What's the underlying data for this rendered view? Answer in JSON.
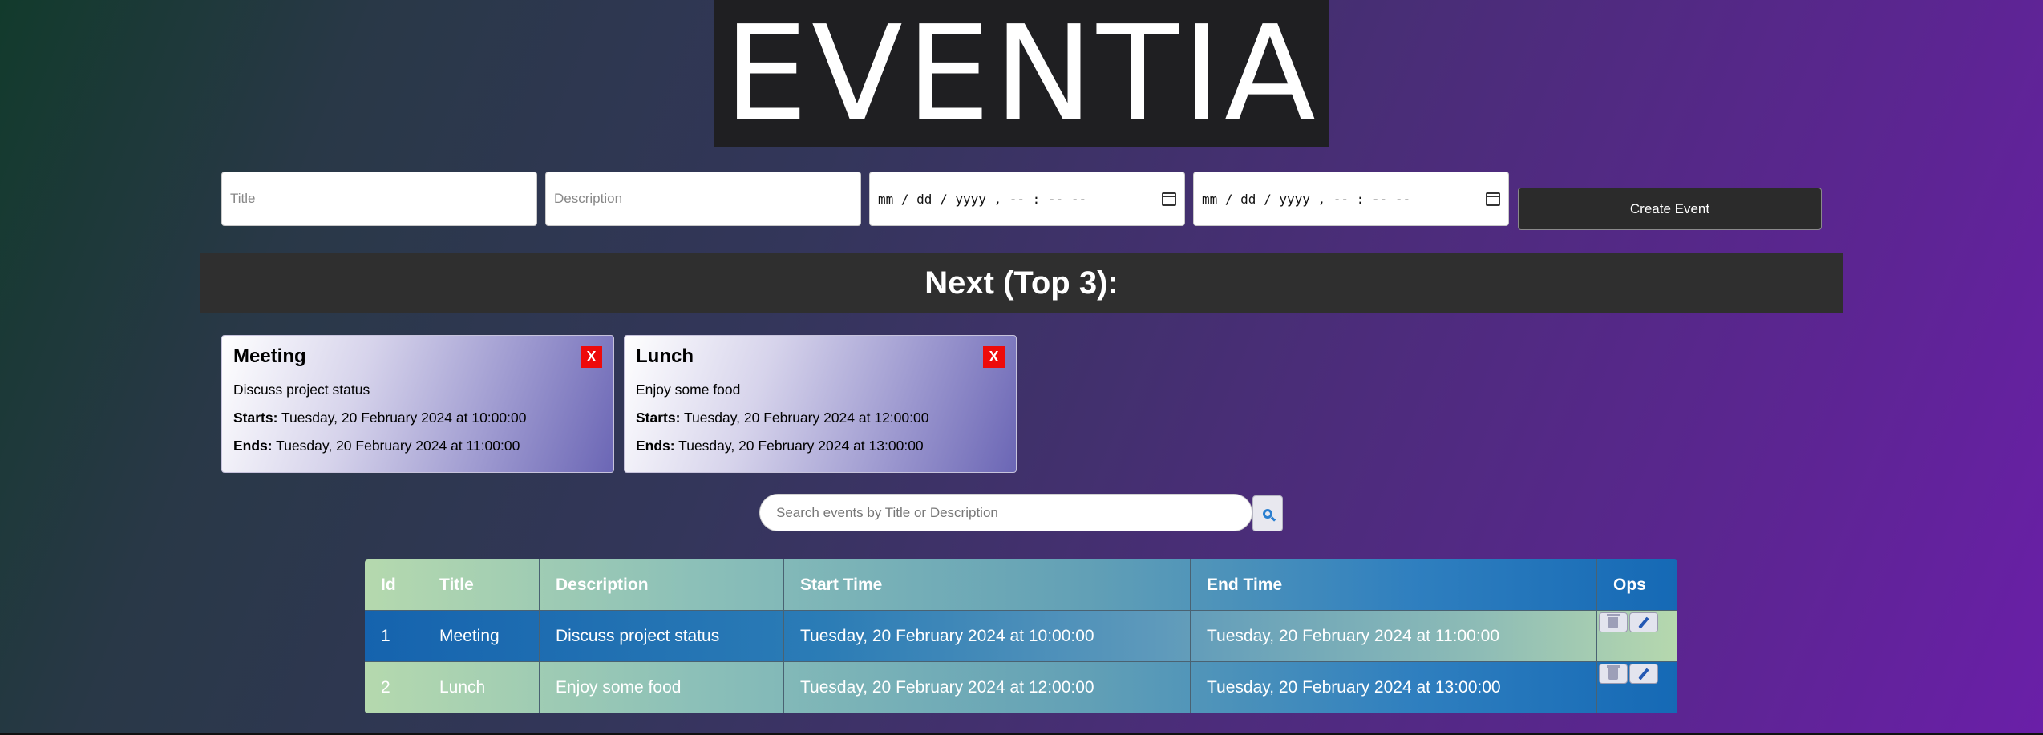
{
  "logo": {
    "text": "EVENTIA"
  },
  "form": {
    "title_placeholder": "Title",
    "description_placeholder": "Description",
    "start_placeholder": "mm / dd / yyyy ,  -- : --  --",
    "end_placeholder": "mm / dd / yyyy ,  -- : --  --",
    "create_label": "Create Event"
  },
  "next": {
    "heading": "Next (Top 3):"
  },
  "cards": [
    {
      "title": "Meeting",
      "description": "Discuss project status",
      "starts_label": "Starts:",
      "starts": "Tuesday, 20 February 2024 at 10:00:00",
      "ends_label": "Ends:",
      "ends": "Tuesday, 20 February 2024 at 11:00:00",
      "close": "X"
    },
    {
      "title": "Lunch",
      "description": "Enjoy some food",
      "starts_label": "Starts:",
      "starts": "Tuesday, 20 February 2024 at 12:00:00",
      "ends_label": "Ends:",
      "ends": "Tuesday, 20 February 2024 at 13:00:00",
      "close": "X"
    }
  ],
  "search": {
    "placeholder": "Search events by Title or Description",
    "icon": "search-icon"
  },
  "table": {
    "headers": [
      "Id",
      "Title",
      "Description",
      "Start Time",
      "End Time",
      "Ops"
    ],
    "rows": [
      [
        "1",
        "Meeting",
        "Discuss project status",
        "Tuesday, 20 February 2024 at 10:00:00",
        "Tuesday, 20 February 2024 at 11:00:00"
      ],
      [
        "2",
        "Lunch",
        "Enjoy some food",
        "Tuesday, 20 February 2024 at 12:00:00",
        "Tuesday, 20 February 2024 at 13:00:00"
      ]
    ]
  },
  "colors": {
    "close_button": "#ee0a0a",
    "panel_dark": "#2f2f2f",
    "accent_blue": "#1569b5",
    "accent_green": "#b5d9ae"
  }
}
